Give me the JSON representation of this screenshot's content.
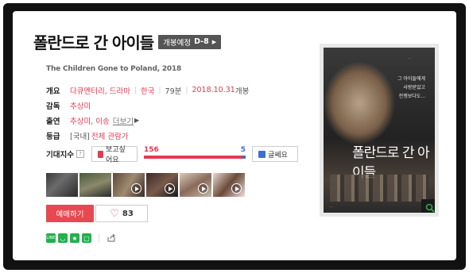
{
  "movie": {
    "title": "폴란드로 간 아이들",
    "release_badge": "개봉예정",
    "dday": "D-8",
    "english_title": "The Children Gone to Poland, 2018"
  },
  "info": {
    "overview_label": "개요",
    "genre": "다큐멘터리, 드라마",
    "country": "한국",
    "runtime": "79분",
    "release_date": "2018.10.31",
    "release_suffix": "개봉",
    "director_label": "감독",
    "director": "추상미",
    "cast_label": "출연",
    "cast": "추상미, 이송",
    "cast_more": "더보기",
    "rating_label": "등급",
    "rating_region": "[국내]",
    "rating": "전체 관람가"
  },
  "expectation": {
    "label": "기대지수",
    "help": "?",
    "like_label": "보고싶어요",
    "dislike_label": "글쎄요",
    "like_count": "156",
    "dislike_count": "5",
    "like_ratio": 0.969
  },
  "actions": {
    "reserve_label": "예매하기",
    "like_count": "83"
  },
  "colors": {
    "accent_red": "#e8384f",
    "accent_blue": "#3c6fd1",
    "share_green": "#22b14c"
  },
  "poster": {
    "small_text": "...",
    "quote_line1": "그 아이들에게",
    "quote_line2": "사랑받았고",
    "quote_line3": "전쟁보다도...",
    "title": "폴란드로 간 아이들",
    "bottom_text": "..."
  },
  "icons": {
    "help": "question-mark-icon",
    "like": "thumbs-up-icon",
    "dislike": "thumbs-down-icon",
    "heart": "heart-icon",
    "zoom": "magnifier-icon",
    "share": "share-icon"
  }
}
